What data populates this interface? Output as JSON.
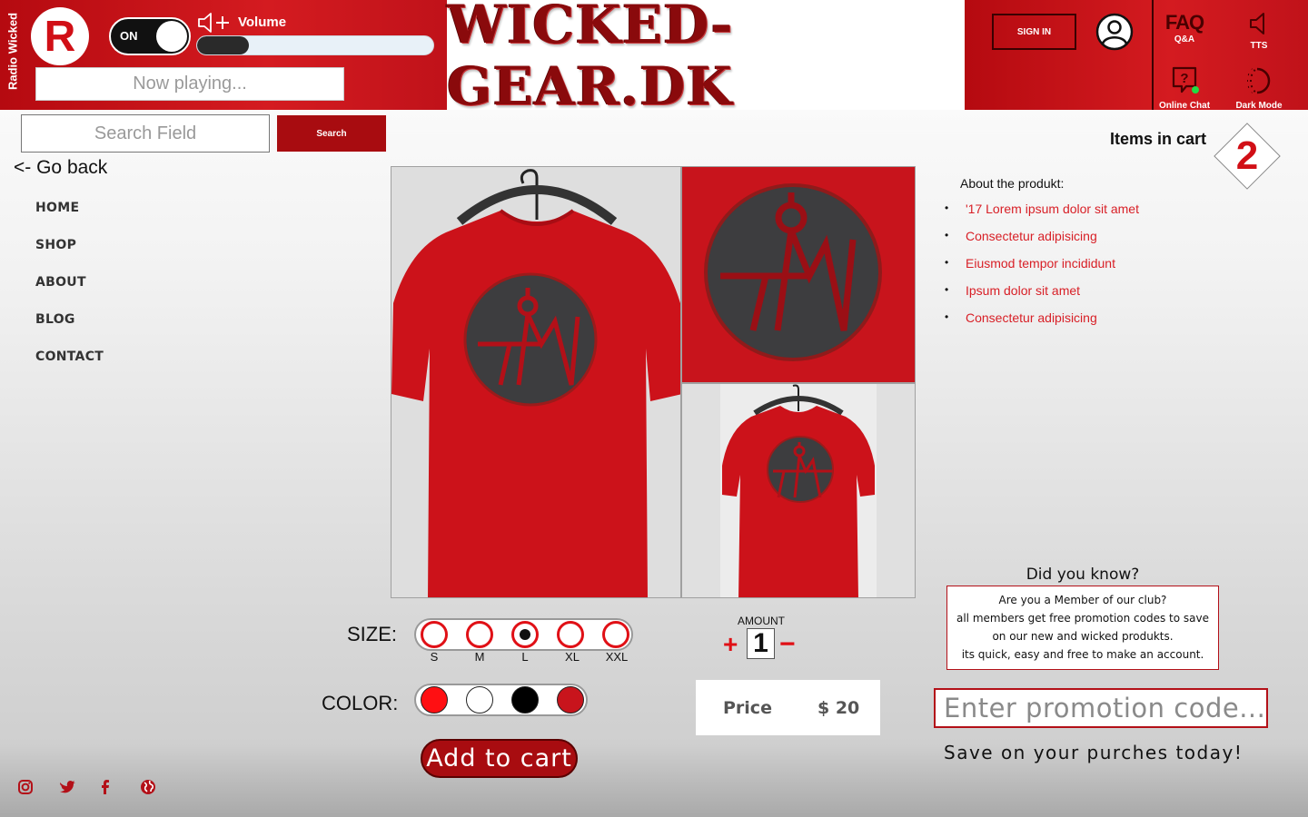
{
  "radio": {
    "brand": "Radio Wicked",
    "logo_letter": "R",
    "toggle_label": "ON",
    "volume_label": "Volume",
    "volume_level": 0.22,
    "now_playing_placeholder": "Now playing..."
  },
  "site_title": "WICKED-GEAR.DK",
  "header_tools": {
    "sign_in": "SIGN IN",
    "faq_big": "FAQ",
    "faq_label": "Q&A",
    "tts_label": "TTS",
    "chat_label": "Online Chat",
    "dark_mode_label": "Dark Mode"
  },
  "search": {
    "placeholder": "Search Field",
    "button": "Search"
  },
  "go_back": "<- Go back",
  "nav": [
    "HOME",
    "SHOP",
    "ABOUT",
    "BLOG",
    "CONTACT"
  ],
  "cart": {
    "label": "Items in cart",
    "count": "2"
  },
  "about": {
    "title": "About the produkt:",
    "items": [
      "'17 Lorem ipsum dolor sit amet",
      "Consectetur adipisicing",
      "Eiusmod tempor incididunt",
      "Ipsum dolor sit amet",
      "Consectetur adipisicing"
    ]
  },
  "options": {
    "size_label": "SIZE:",
    "sizes": [
      "S",
      "M",
      "L",
      "XL",
      "XXL"
    ],
    "selected_size": "L",
    "color_label": "COLOR:",
    "colors": [
      "#ff0f12",
      "#ffffff",
      "#000000",
      "#c8141c"
    ]
  },
  "amount": {
    "label": "AMOUNT",
    "value": "1"
  },
  "price": {
    "label": "Price",
    "value": "$ 20"
  },
  "add_to_cart": "Add to cart",
  "did_you_know": {
    "title": "Did you know?",
    "lines": [
      "Are you a Member of our club?",
      "all members get free promotion codes to save",
      "on our new and wicked produkts.",
      "its quick, easy and free to make an account."
    ]
  },
  "promo": {
    "placeholder": "Enter promotion code...",
    "caption": "Save on your purches today!"
  },
  "social_icons": [
    "instagram-icon",
    "twitter-icon",
    "facebook-icon",
    "globe-icon"
  ],
  "accent": "#b50a10"
}
